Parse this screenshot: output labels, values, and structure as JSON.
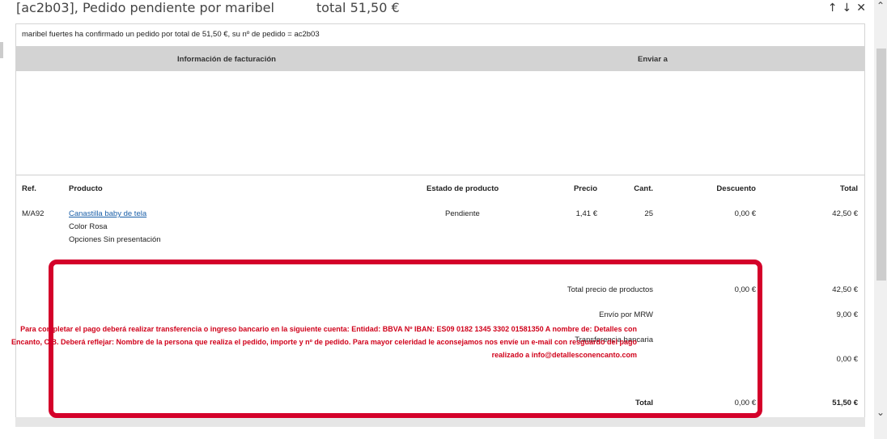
{
  "header": {
    "subject": "[ac2b03], Pedido pendiente por maribel",
    "total": "total 51,50 €",
    "icons": [
      "arrow-up-icon",
      "arrow-down-icon",
      "close-icon"
    ]
  },
  "mail": {
    "intro": "maribel fuertes ha confirmado un pedido por total de 51,50 €, su nº de pedido = ac2b03",
    "billing_header": "Información de facturación",
    "ship_header": "Enviar a",
    "columns": [
      "Ref.",
      "Producto",
      "Estado de producto",
      "Precio",
      "Cant.",
      "Descuento",
      "Total"
    ],
    "item": {
      "ref": "M/A92",
      "product": "Canastilla baby de tela",
      "color": "Color Rosa",
      "options": "Opciones Sin presentación",
      "status": "Pendiente",
      "price": "1,41 €",
      "qty": "25",
      "discount": "0,00 €",
      "total": "42,50 €"
    },
    "summary": {
      "products_label": "Total precio de productos",
      "products_discount": "0,00 €",
      "products_total": "42,50 €",
      "shipping_label": "Envío por MRW",
      "shipping_total": "9,00 €",
      "payment_label": "Transferencia bancaria",
      "payment_notice": "Para completar el pago deberá realizar transferencia o ingreso bancario en la siguiente cuenta: Entidad: BBVA Nº IBAN: ES09 0182 1345 3302 01581350 A nombre de: Detalles con Encanto, C.B. Deberá reflejar: Nombre de la persona que realiza el pedido, importe y nº de pedido. Para mayor celeridad le aconsejamos nos envíe un e-mail con resguardo del pago realizado a info@detallesconencanto.com",
      "payment_total": "0,00 €",
      "total_label": "Total",
      "total_discount": "0,00 €",
      "grand_total": "51,50 €"
    }
  },
  "colors": {
    "highlight": "#d4002a",
    "notice": "#d0021b",
    "link": "#1a5fa8",
    "header_band": "#d3d3d3"
  }
}
